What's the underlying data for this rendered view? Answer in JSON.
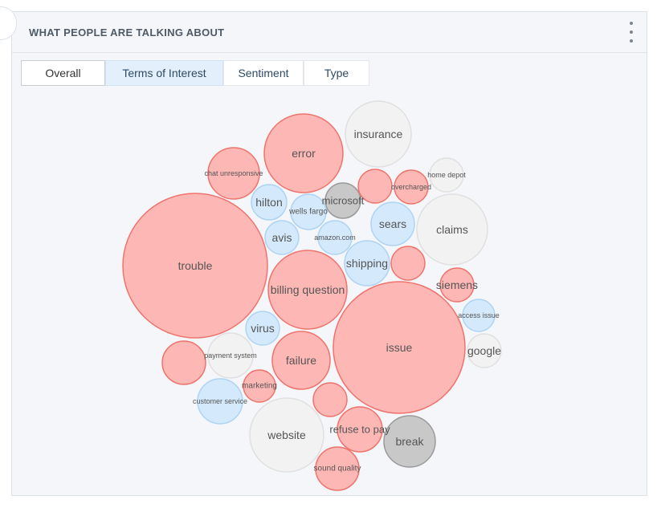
{
  "widget": {
    "title": "WHAT PEOPLE ARE TALKING ABOUT",
    "tabs": [
      {
        "label": "Overall",
        "selected": false
      },
      {
        "label": "Terms of Interest",
        "selected": true
      },
      {
        "label": "Sentiment",
        "selected": false
      },
      {
        "label": "Type",
        "selected": false
      }
    ],
    "menu_icon": "kebab-menu-icon"
  },
  "colors": {
    "negative_fill": "#fdb8b6",
    "negative_stroke": "#f0736c",
    "neutral_fill": "#f2f2f2",
    "neutral_stroke": "#e0e0e0",
    "positive_fill": "#d4e9fb",
    "positive_stroke": "#aed4f5",
    "dark_fill": "#c8c8c8",
    "dark_stroke": "#9a9a9a"
  },
  "chart_data": {
    "type": "bubble",
    "bubbles": [
      {
        "label": "trouble",
        "category": "negative",
        "size": 90
      },
      {
        "label": "issue",
        "category": "negative",
        "size": 82
      },
      {
        "label": "error",
        "category": "negative",
        "size": 49
      },
      {
        "label": "billing question",
        "category": "negative",
        "size": 49
      },
      {
        "label": "website",
        "category": "neutral",
        "size": 46
      },
      {
        "label": "claims",
        "category": "neutral",
        "size": 44
      },
      {
        "label": "insurance",
        "category": "neutral",
        "size": 41
      },
      {
        "label": "failure",
        "category": "negative",
        "size": 36
      },
      {
        "label": "break",
        "category": "dark",
        "size": 32
      },
      {
        "label": "chat unresponsive",
        "category": "negative",
        "size": 32
      },
      {
        "label": "refuse to pay",
        "category": "negative",
        "size": 28
      },
      {
        "label": "customer service",
        "category": "positive",
        "size": 28
      },
      {
        "label": "shipping",
        "category": "positive",
        "size": 28
      },
      {
        "label": "payment system",
        "category": "neutral",
        "size": 28
      },
      {
        "label": "sears",
        "category": "positive",
        "size": 27
      },
      {
        "label": "sound quality",
        "category": "negative",
        "size": 27
      },
      {
        "label": "",
        "category": "negative",
        "size": 27
      },
      {
        "label": "hilton",
        "category": "positive",
        "size": 22
      },
      {
        "label": "microsoft",
        "category": "dark",
        "size": 22
      },
      {
        "label": "wells fargo",
        "category": "positive",
        "size": 22
      },
      {
        "label": "amazon.com",
        "category": "positive",
        "size": 21
      },
      {
        "label": "virus",
        "category": "positive",
        "size": 21
      },
      {
        "label": "",
        "category": "negative",
        "size": 21
      },
      {
        "label": "",
        "category": "negative",
        "size": 21
      },
      {
        "label": "avis",
        "category": "positive",
        "size": 21
      },
      {
        "label": "google",
        "category": "neutral",
        "size": 21
      },
      {
        "label": "siemens",
        "category": "negative",
        "size": 21
      },
      {
        "label": "overcharged",
        "category": "negative",
        "size": 21
      },
      {
        "label": "home depot",
        "category": "neutral",
        "size": 21
      },
      {
        "label": "",
        "category": "negative",
        "size": 21
      },
      {
        "label": "access issue",
        "category": "positive",
        "size": 20
      },
      {
        "label": "marketing",
        "category": "negative",
        "size": 20
      }
    ]
  }
}
